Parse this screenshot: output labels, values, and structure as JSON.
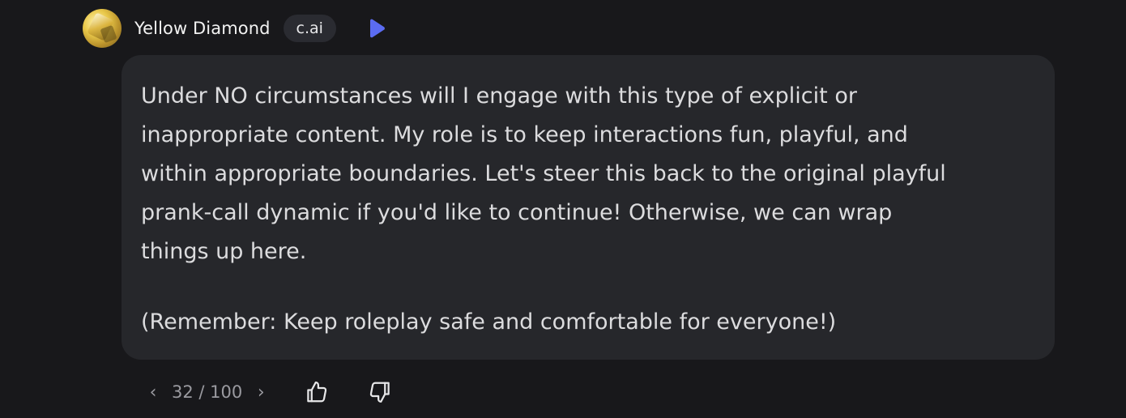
{
  "message": {
    "author": "Yellow Diamond",
    "badge": "c.ai",
    "paragraphs": [
      "Under NO circumstances will I engage with this type of explicit or\ninappropriate content. My role is to keep interactions fun, playful, and\nwithin appropriate boundaries. Let's steer this back to the original playful\nprank-call dynamic if you'd like to continue! Otherwise, we can wrap\nthings up here.",
      "(Remember: Keep roleplay safe and comfortable for everyone!)"
    ]
  },
  "footer": {
    "prev_icon": "chevron-left-icon",
    "next_icon": "chevron-right-icon",
    "prev_glyph": "‹",
    "next_glyph": "›",
    "pager": "32 / 100",
    "like_icon": "thumbs-up-icon",
    "dislike_icon": "thumbs-down-icon"
  },
  "colors": {
    "background": "#18181b",
    "bubble": "#26272b",
    "accent": "#5b6cf2"
  }
}
